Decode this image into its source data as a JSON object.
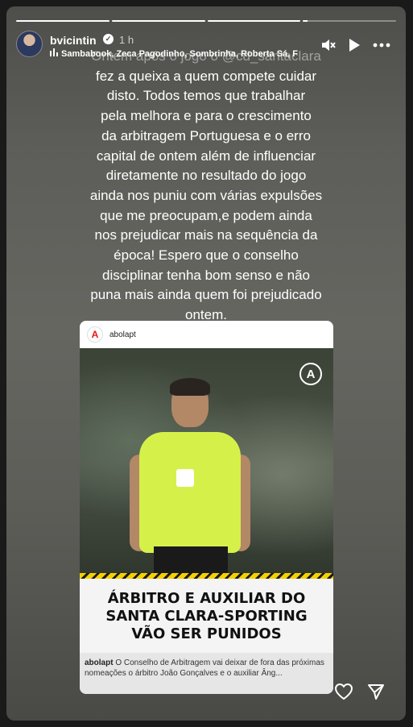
{
  "story": {
    "progress": [
      1,
      1,
      1,
      0.05
    ],
    "username": "bvicintin",
    "time_ago": "1 h",
    "music": "Sambabook, Zeca Pagodinho, Sombrinha, Roberta Sá, F",
    "caption_lines": [
      "Ontem após o jogo o @cd_santaclara",
      "fez a queixa a quem compete cuidar",
      "disto. Todos temos que trabalhar",
      "pela melhora e para o crescimento",
      "da arbitragem Portuguesa e o erro",
      "capital de ontem além de influenciar",
      "diretamente no resultado do jogo",
      "ainda nos puniu com várias expulsões",
      "que me preocupam,e podem ainda",
      "nos prejudicar mais na sequência da",
      "época! Espero que o conselho",
      "disciplinar tenha bom senso e não",
      "puna mais ainda quem foi prejudicado",
      "ontem."
    ]
  },
  "post": {
    "account": "abolapt",
    "logo_letter": "A",
    "headline_lines": [
      "ÁRBITRO E AUXILIAR DO",
      "SANTA CLARA-SPORTING",
      "VÃO SER PUNIDOS"
    ],
    "caption_user": "abolapt",
    "caption_text": "O Conselho de Arbitragem vai deixar de fora das próximas nomeações o árbitro João Gonçalves e o auxiliar Âng..."
  },
  "icons": {
    "verified": "verified-badge-icon",
    "mute": "speaker-muted-icon",
    "play": "play-icon",
    "more": "more-icon",
    "like": "heart-icon",
    "share": "send-icon"
  }
}
